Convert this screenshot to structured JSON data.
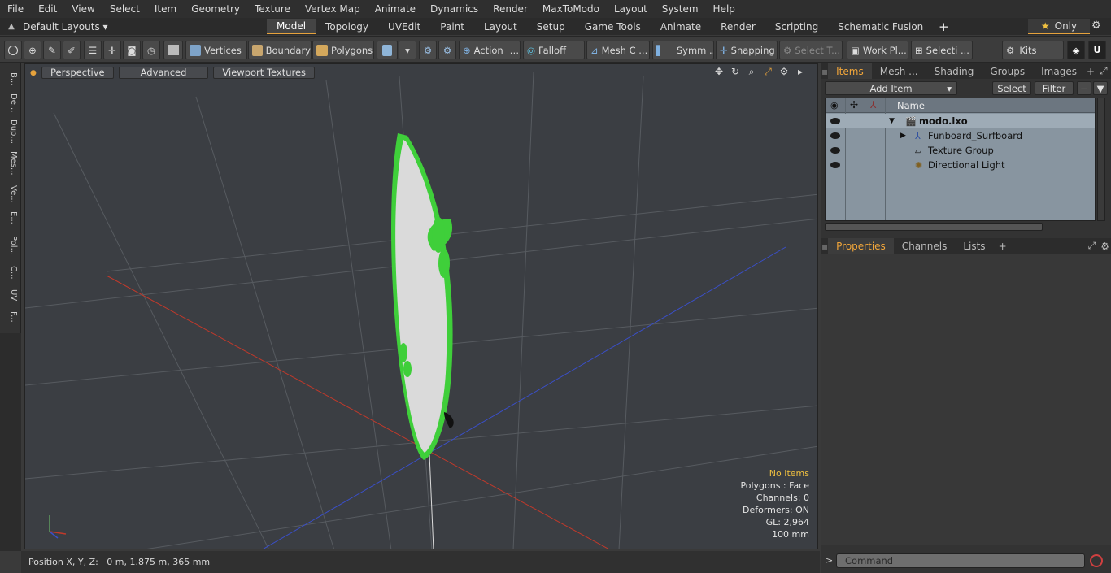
{
  "menu": [
    "File",
    "Edit",
    "View",
    "Select",
    "Item",
    "Geometry",
    "Texture",
    "Vertex Map",
    "Animate",
    "Dynamics",
    "Render",
    "MaxToModo",
    "Layout",
    "System",
    "Help"
  ],
  "layoutbar": {
    "layouts_label": "Default Layouts",
    "tabs": [
      "Model",
      "Topology",
      "UVEdit",
      "Paint",
      "Layout",
      "Setup",
      "Game Tools",
      "Animate",
      "Render",
      "Scripting",
      "Schematic Fusion"
    ],
    "active_tab": "Model",
    "only_label": "Only"
  },
  "toolbar": {
    "vertices": "Vertices",
    "boundary": "Boundary",
    "polygons": "Polygons",
    "action": "Action",
    "falloff": "Falloff",
    "meshc": "Mesh C ...",
    "symm": "Symm ...",
    "snapping": "Snapping",
    "selectt": "Select T...",
    "workpl": "Work Pl...",
    "selecti": "Selecti ...",
    "kits": "Kits"
  },
  "lefttabs": [
    "B...",
    "De...",
    "Dup...",
    "Mes...",
    "Ve...",
    "E...",
    "Pol...",
    "C...",
    "UV",
    "F..."
  ],
  "viewport": {
    "perspective": "Perspective",
    "advanced": "Advanced",
    "textures": "Viewport Textures",
    "info": {
      "no_items": "No Items",
      "polygons": "Polygons : Face",
      "channels": "Channels: 0",
      "deformers": "Deformers: ON",
      "gl": "GL: 2,964",
      "scale": "100 mm"
    }
  },
  "status": {
    "position": "Position X, Y, Z:   0 m, 1.875 m, 365 mm"
  },
  "items_panel": {
    "tabs": [
      "Items",
      "Mesh ...",
      "Shading",
      "Groups",
      "Images"
    ],
    "add_item": "Add Item",
    "select": "Select",
    "filter": "Filter",
    "col_name": "Name",
    "rows": [
      {
        "label": "modo.lxo",
        "bold": true
      },
      {
        "label": "Funboard_Surfboard"
      },
      {
        "label": "Texture Group"
      },
      {
        "label": "Directional Light"
      }
    ]
  },
  "props_panel": {
    "tabs": [
      "Properties",
      "Channels",
      "Lists"
    ]
  },
  "command": {
    "placeholder": "Command"
  },
  "colors": {
    "accent": "#e6a23c",
    "board_green": "#3fcf3a",
    "x_axis": "#c0392b",
    "z_axis": "#3a4fc8"
  }
}
